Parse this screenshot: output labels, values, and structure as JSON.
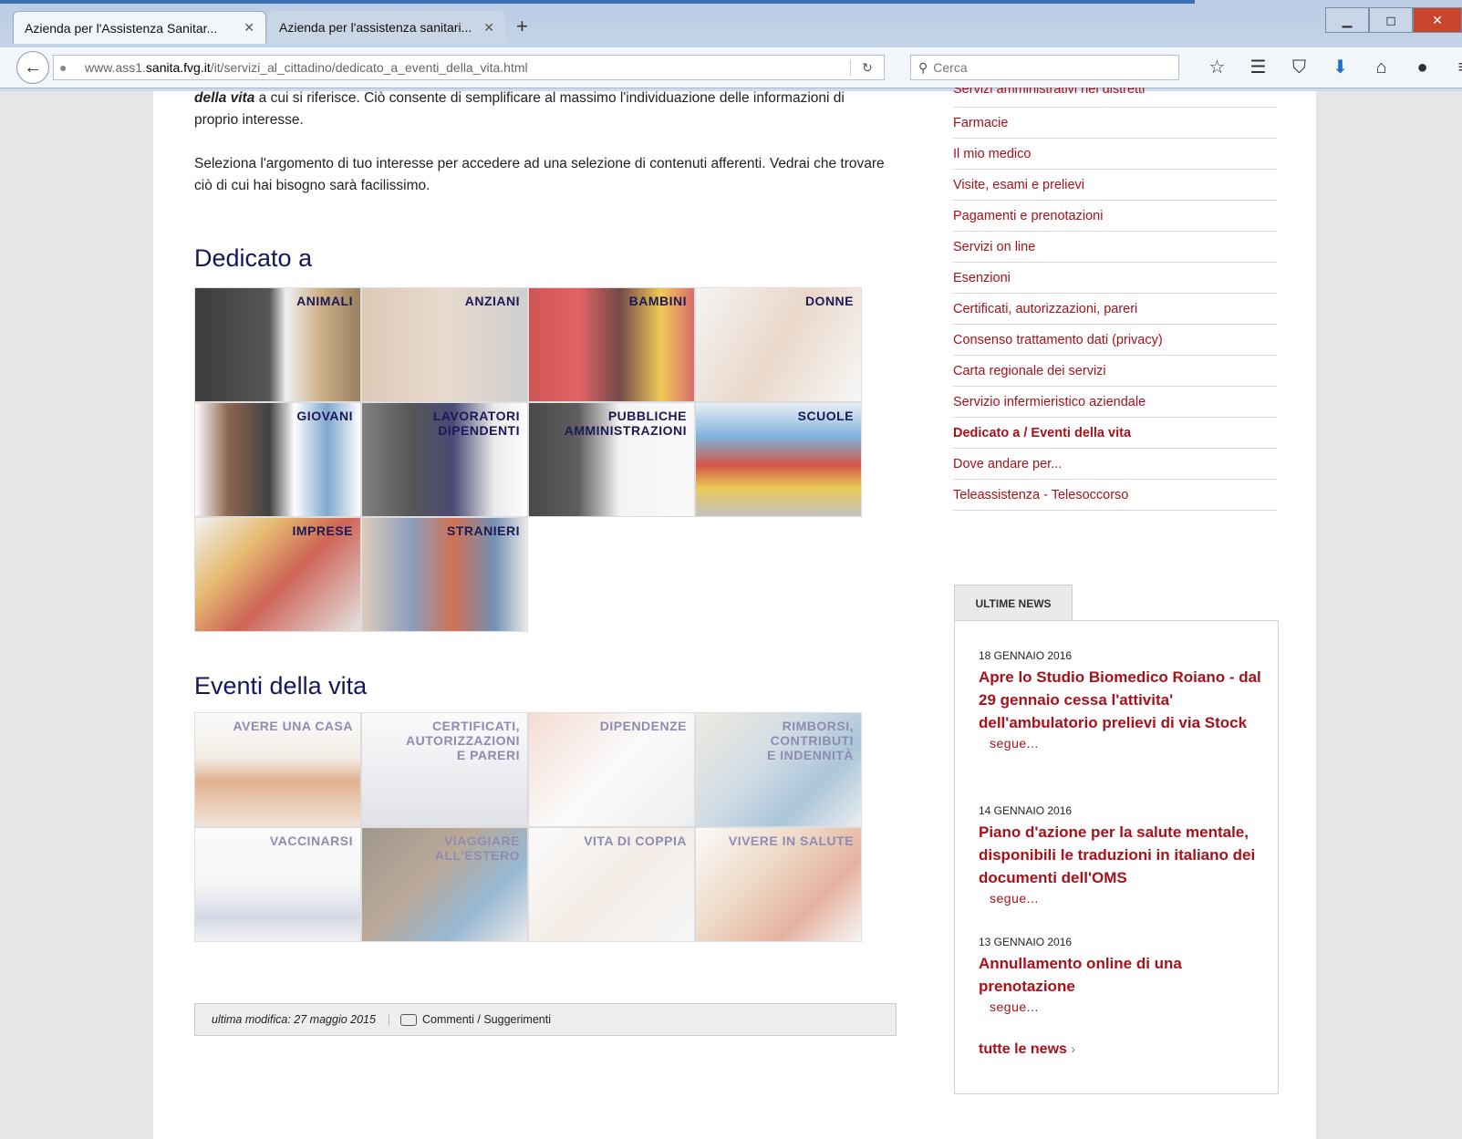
{
  "browser": {
    "tabs": [
      {
        "title": "Azienda per l'Assistenza Sanitar...",
        "close": "✕"
      },
      {
        "title": "Azienda per l'assistenza sanitari...",
        "close": "✕"
      }
    ],
    "new_tab": "+",
    "url_prefix": "www.ass1.",
    "url_domain": "sanita.fvg.it",
    "url_path": "/it/servizi_al_cittadino/dedicato_a_eventi_della_vita.html",
    "search_placeholder": "Cerca"
  },
  "intro": {
    "p1_bold": "della vita",
    "p1_rest": " a cui si riferisce. Ciò consente di semplificare al massimo l'individuazione delle informazioni di proprio interesse.",
    "p2": "Seleziona l'argomento di tuo interesse per accedere ad una selezione di contenuti afferenti. Vedrai che trovare ciò di cui hai bisogno sarà facilissimo."
  },
  "dedicato": {
    "heading": "Dedicato a",
    "tiles": [
      {
        "label": "ANIMALI"
      },
      {
        "label": "ANZIANI"
      },
      {
        "label": "BAMBINI"
      },
      {
        "label": "DONNE"
      },
      {
        "label": "GIOVANI"
      },
      {
        "label": "LAVORATORI\nDIPENDENTI"
      },
      {
        "label": "PUBBLICHE\nAMMINISTRAZIONI"
      },
      {
        "label": "SCUOLE"
      },
      {
        "label": "IMPRESE"
      },
      {
        "label": "STRANIERI"
      }
    ]
  },
  "eventi": {
    "heading": "Eventi della vita",
    "tiles": [
      {
        "label": "AVERE UNA CASA"
      },
      {
        "label": "CERTIFICATI,\nAUTORIZZAZIONI\nE PARERI"
      },
      {
        "label": "DIPENDENZE"
      },
      {
        "label": "RIMBORSI,\nCONTRIBUTI\nE INDENNITÀ"
      },
      {
        "label": "VACCINARSI"
      },
      {
        "label": "VIAGGIARE\nALL'ESTERO"
      },
      {
        "label": "VITA DI COPPIA"
      },
      {
        "label": "VIVERE IN SALUTE"
      }
    ]
  },
  "footer": {
    "last_modified": "ultima modifica: 27 maggio 2015",
    "comments": "Commenti / Suggerimenti"
  },
  "sidebar": {
    "menu": [
      "Servizi amministrativi nei distretti",
      "Farmacie",
      "Il mio medico",
      "Visite, esami e prelievi",
      "Pagamenti e prenotazioni",
      "Servizi on line",
      "Esenzioni",
      "Certificati, autorizzazioni, pareri",
      "Consenso trattamento dati (privacy)",
      "Carta regionale dei servizi",
      "Servizio infermieristico aziendale",
      "Dedicato a / Eventi della vita",
      "Dove andare per...",
      "Teleassistenza - Telesoccorso"
    ],
    "current_index": 11,
    "news_tab": "ULTIME NEWS",
    "news": [
      {
        "date": "18 GENNAIO 2016",
        "title": "Apre lo Studio Biomedico Roiano - dal 29 gennaio cessa l'attivita' dell'ambulatorio prelievi di via Stock",
        "more": "segue..."
      },
      {
        "date": "14 GENNAIO 2016",
        "title": "Piano d'azione per la salute mentale, disponibili le traduzioni in italiano dei documenti dell'OMS",
        "more": "segue..."
      },
      {
        "date": "13 GENNAIO 2016",
        "title": "Annullamento online di una prenotazione",
        "more": "segue..."
      }
    ],
    "all_news": "tutte le news"
  }
}
